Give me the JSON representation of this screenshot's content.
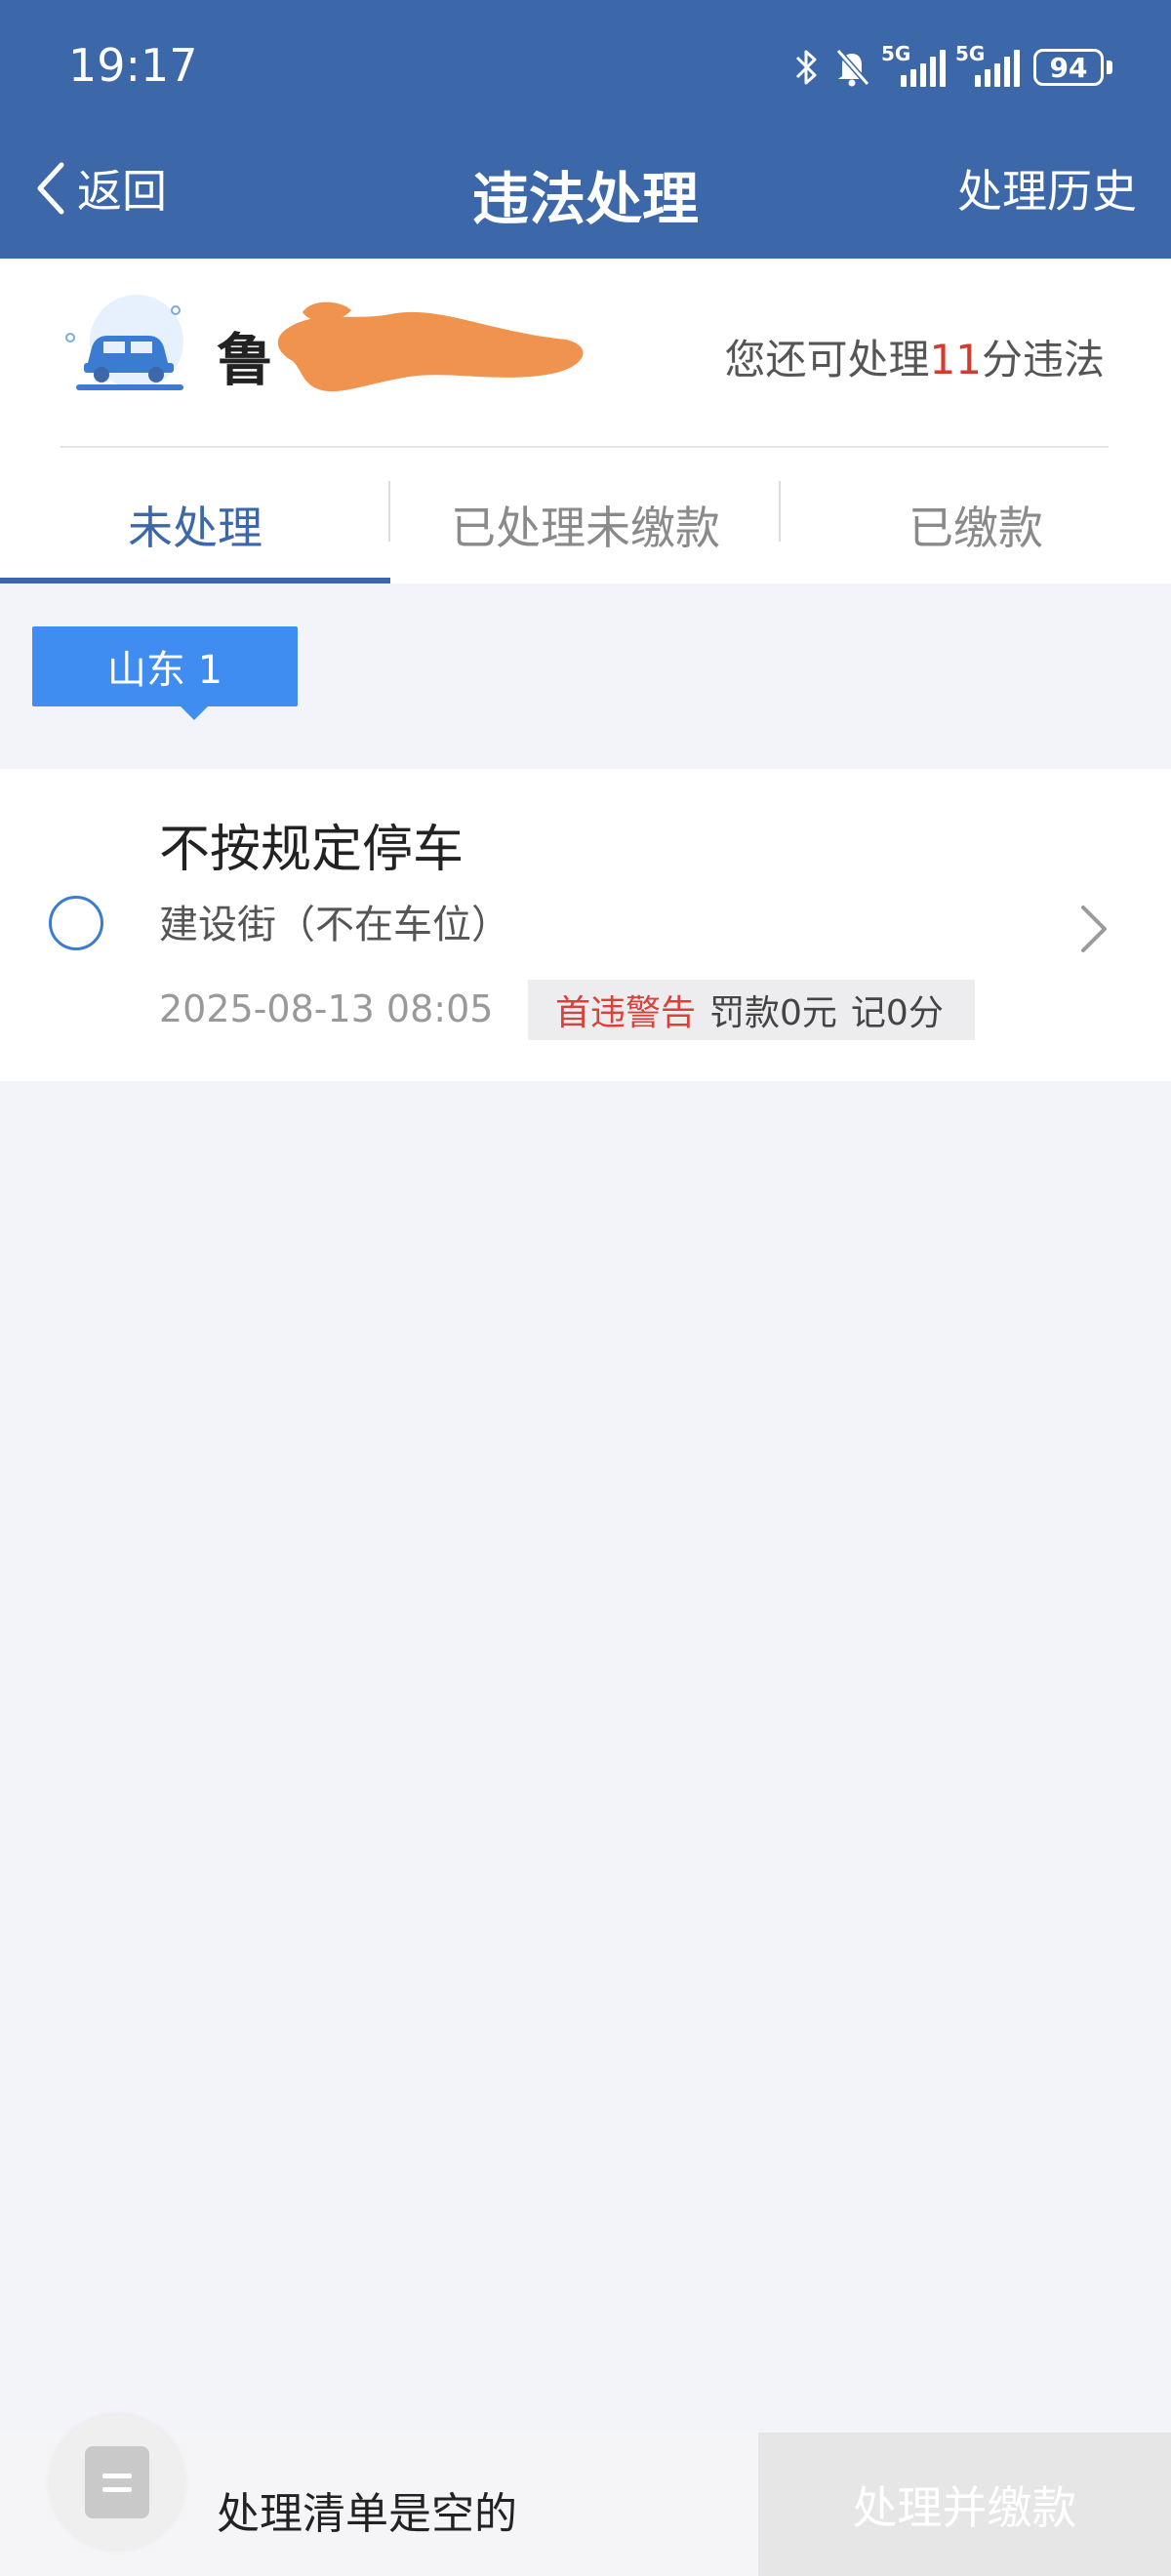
{
  "status_bar": {
    "time": "19:17",
    "network_1": "5G",
    "network_2": "5G",
    "battery": "94",
    "icons": [
      "bluetooth-icon",
      "bell-muted-icon",
      "signal-icon",
      "signal-icon",
      "battery-icon"
    ]
  },
  "header": {
    "back_label": "返回",
    "title": "违法处理",
    "history_label": "处理历史"
  },
  "vehicle": {
    "plate_prefix": "鲁",
    "remaining_prefix": "您还可处理",
    "remaining_points": "11",
    "remaining_suffix": "分违法"
  },
  "tabs": [
    {
      "label": "未处理",
      "active": true
    },
    {
      "label": "已处理未缴款",
      "active": false
    },
    {
      "label": "已缴款",
      "active": false
    }
  ],
  "region_tag": "山东 1",
  "violations": [
    {
      "title": "不按规定停车",
      "location": "建设街（不在车位）",
      "datetime": "2025-08-13 08:05",
      "warning": "首违警告",
      "fine": "罚款0元",
      "points": "记0分"
    }
  ],
  "bottom": {
    "empty_text": "处理清单是空的",
    "pay_button": "处理并缴款"
  },
  "colors": {
    "header": "#3c67a8",
    "accent_blue": "#3f8df0",
    "warning_red": "#d9423a",
    "background": "#f3f4f9"
  }
}
